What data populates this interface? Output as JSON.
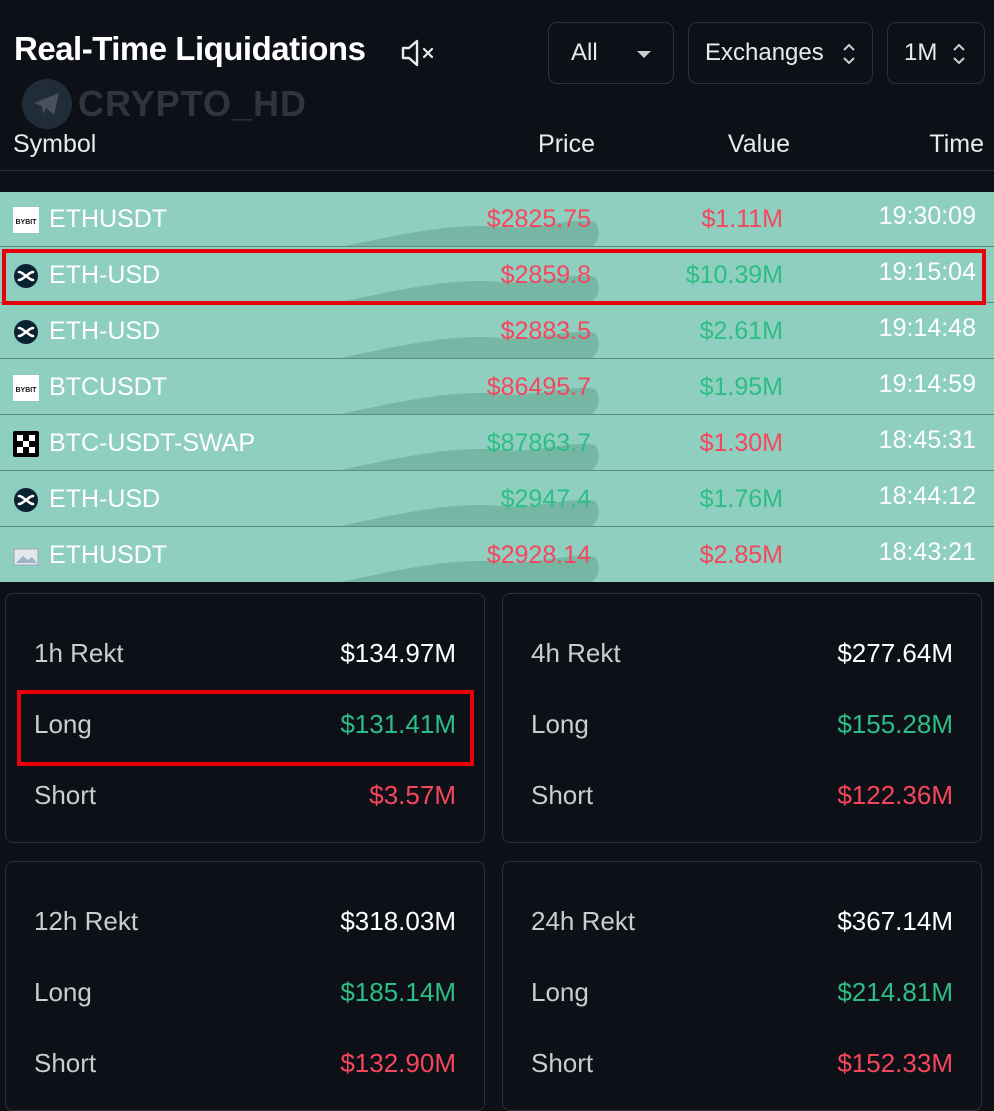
{
  "header": {
    "title": "Real-Time Liquidations",
    "watermark": "CRYPTO_HD"
  },
  "filters": {
    "type_selected": "All",
    "exchanges_label": "Exchanges",
    "period_selected": "1M"
  },
  "table": {
    "columns": [
      "Symbol",
      "Price",
      "Value",
      "Time"
    ],
    "rows": [
      {
        "exchange_icon": "bybit-icon",
        "symbol": "ETHUSDT",
        "price": "$2825.75",
        "price_color": "red",
        "value": "$1.11M",
        "value_color": "red",
        "time": "19:30:09"
      },
      {
        "exchange_icon": "bitmex-icon",
        "symbol": "ETH-USD",
        "price": "$2859.8",
        "price_color": "red",
        "value": "$10.39M",
        "value_color": "green",
        "time": "19:15:04"
      },
      {
        "exchange_icon": "bitmex-icon",
        "symbol": "ETH-USD",
        "price": "$2883.5",
        "price_color": "red",
        "value": "$2.61M",
        "value_color": "green",
        "time": "19:14:48"
      },
      {
        "exchange_icon": "bybit-icon",
        "symbol": "BTCUSDT",
        "price": "$86495.7",
        "price_color": "red",
        "value": "$1.95M",
        "value_color": "green",
        "time": "19:14:59"
      },
      {
        "exchange_icon": "okx-icon",
        "symbol": "BTC-USDT-SWAP",
        "price": "$87863.7",
        "price_color": "green",
        "value": "$1.30M",
        "value_color": "red",
        "time": "18:45:31"
      },
      {
        "exchange_icon": "bitmex-icon",
        "symbol": "ETH-USD",
        "price": "$2947.4",
        "price_color": "green",
        "value": "$1.76M",
        "value_color": "green",
        "time": "18:44:12"
      },
      {
        "exchange_icon": "image-placeholder-icon",
        "symbol": "ETHUSDT",
        "price": "$2928.14",
        "price_color": "red",
        "value": "$2.85M",
        "value_color": "red",
        "time": "18:43:21"
      }
    ]
  },
  "stats": [
    {
      "title": "1h Rekt",
      "total": "$134.97M",
      "long_label": "Long",
      "long": "$131.41M",
      "short_label": "Short",
      "short": "$3.57M"
    },
    {
      "title": "4h Rekt",
      "total": "$277.64M",
      "long_label": "Long",
      "long": "$155.28M",
      "short_label": "Short",
      "short": "$122.36M"
    },
    {
      "title": "12h Rekt",
      "total": "$318.03M",
      "long_label": "Long",
      "long": "$185.14M",
      "short_label": "Short",
      "short": "$132.90M"
    },
    {
      "title": "24h Rekt",
      "total": "$367.14M",
      "long_label": "Long",
      "long": "$214.81M",
      "short_label": "Short",
      "short": "$152.33M"
    }
  ],
  "colors": {
    "red": "#f6465d",
    "green": "#2ebd85",
    "row_bg": "#8ecfbf",
    "annotation": "#e8000b"
  }
}
